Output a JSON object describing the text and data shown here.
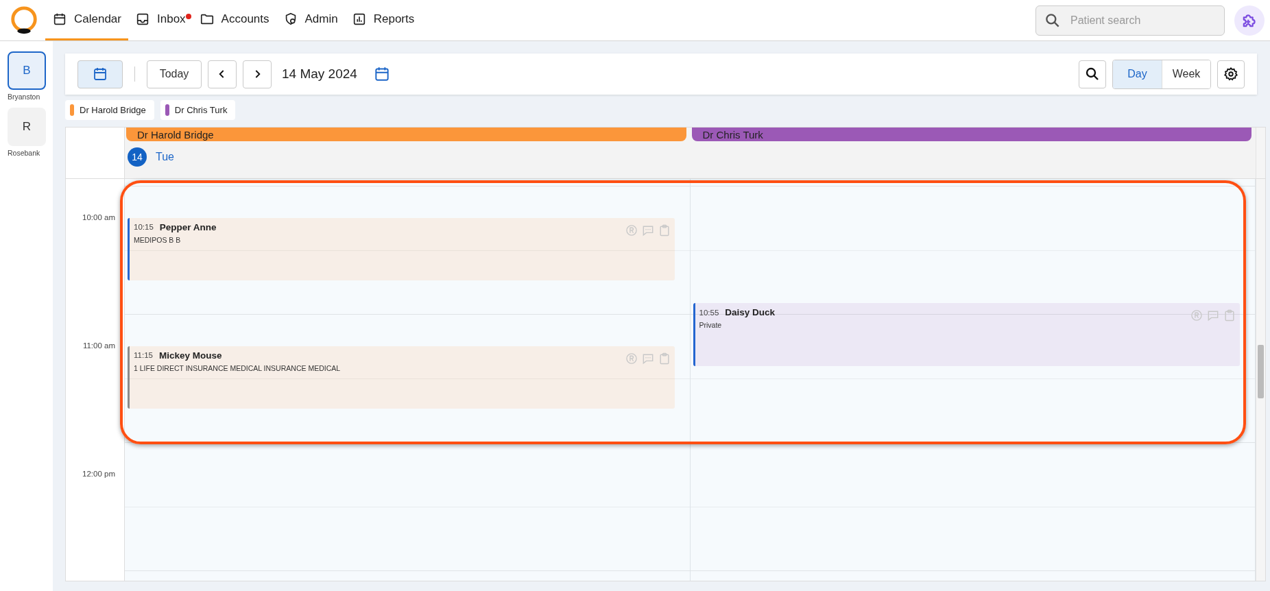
{
  "nav": [
    {
      "label": "Calendar",
      "kind": "calendar",
      "selected": true,
      "notification": false
    },
    {
      "label": "Inbox",
      "kind": "inbox",
      "selected": false,
      "notification": true
    },
    {
      "label": "Accounts",
      "kind": "folder",
      "selected": false,
      "notification": false
    },
    {
      "label": "Admin",
      "kind": "admin",
      "selected": false,
      "notification": false
    },
    {
      "label": "Reports",
      "kind": "reports",
      "selected": false,
      "notification": false
    }
  ],
  "search": {
    "placeholder": "Patient search"
  },
  "locations": [
    {
      "initial": "B",
      "name": "Bryanston",
      "selected": true
    },
    {
      "initial": "R",
      "name": "Rosebank",
      "selected": false
    }
  ],
  "toolbar": {
    "today": "Today",
    "date": "14 May 2024",
    "views": [
      {
        "label": "Day",
        "selected": true
      },
      {
        "label": "Week",
        "selected": false
      }
    ]
  },
  "practitioners": [
    {
      "name": "Dr Harold Bridge",
      "color": "#fb963a"
    },
    {
      "name": "Dr Chris Turk",
      "color": "#9b59b6"
    }
  ],
  "time_labels": [
    "10:00 am",
    "11:00 am",
    "12:00 pm"
  ],
  "columns": [
    {
      "header": "Dr Harold Bridge",
      "color": "#fb963a",
      "date": {
        "number": "14",
        "weekday": "Tue"
      },
      "appointments": [
        {
          "time": "10:15",
          "patient": "Pepper Anne",
          "detail": "MEDIPOS B B",
          "color": "#2466d0"
        },
        {
          "time": "11:15",
          "patient": "Mickey Mouse",
          "detail": "1 LIFE DIRECT INSURANCE MEDICAL INSURANCE MEDICAL",
          "color": "#8a8a8a"
        }
      ]
    },
    {
      "header": "Dr Chris Turk",
      "color": "#9b59b6",
      "appointments": [
        {
          "time": "10:55",
          "patient": "Daisy Duck",
          "detail": "Private",
          "color": "#2466d0"
        }
      ]
    }
  ]
}
